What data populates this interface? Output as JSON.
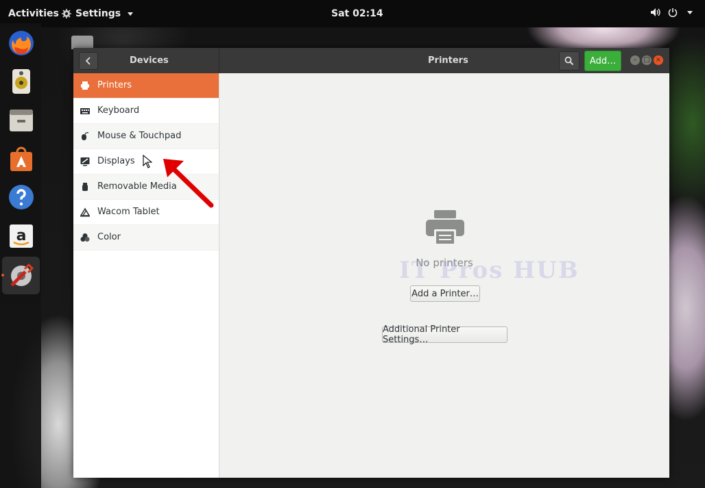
{
  "topbar": {
    "activities": "Activities",
    "app_menu": "Settings",
    "clock": "Sat 02:14"
  },
  "dock": {
    "items": [
      {
        "icon": "firefox-icon"
      },
      {
        "icon": "rhythmbox-icon"
      },
      {
        "icon": "files-icon"
      },
      {
        "icon": "software-center-icon"
      },
      {
        "icon": "help-icon"
      },
      {
        "icon": "amazon-icon"
      },
      {
        "icon": "settings-icon",
        "active": true
      }
    ]
  },
  "window": {
    "panel_title": "Devices",
    "page_title": "Printers",
    "add_button": "Add…"
  },
  "sidebar": {
    "items": [
      {
        "label": "Printers",
        "icon": "printer-icon",
        "selected": true
      },
      {
        "label": "Keyboard",
        "icon": "keyboard-icon"
      },
      {
        "label": "Mouse & Touchpad",
        "icon": "mouse-icon"
      },
      {
        "label": "Displays",
        "icon": "display-icon"
      },
      {
        "label": "Removable Media",
        "icon": "usb-drive-icon"
      },
      {
        "label": "Wacom Tablet",
        "icon": "tablet-icon"
      },
      {
        "label": "Color",
        "icon": "color-icon"
      }
    ]
  },
  "main": {
    "empty_state_text": "No printers",
    "add_printer_button": "Add a Printer…",
    "additional_settings_button": "Additional Printer Settings…",
    "watermark": "IT Pros HUB"
  },
  "colors": {
    "accent": "#e9703a",
    "add_button": "#3cae3c",
    "close_button": "#e95420",
    "annotation_arrow": "#e00000"
  }
}
